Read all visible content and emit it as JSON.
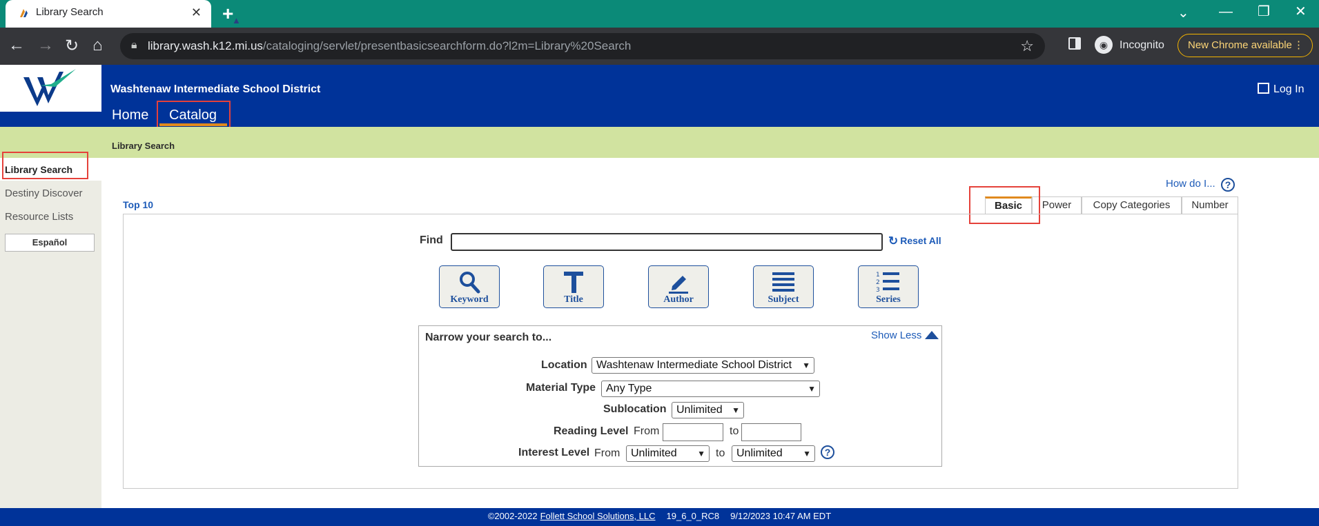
{
  "browser": {
    "tab_title": "Library Search",
    "url_host": "library.wash.k12.mi.us",
    "url_path": "/cataloging/servlet/presentbasicsearchform.do?l2m=Library%20Search",
    "incognito_label": "Incognito",
    "update_label": "New Chrome available"
  },
  "header": {
    "district": "Washtenaw Intermediate School District",
    "login": "Log In",
    "nav": {
      "home": "Home",
      "catalog": "Catalog"
    },
    "breadcrumb": "Library Search"
  },
  "sidebar": {
    "items": [
      "Library Search",
      "Destiny Discover",
      "Resource Lists"
    ],
    "language_button": "Español"
  },
  "main": {
    "how_do_i": "How do I...",
    "top10": "Top 10",
    "tabs": [
      "Basic",
      "Power",
      "Copy Categories",
      "Number"
    ],
    "find_label": "Find",
    "find_value": "",
    "reset_all": "Reset All",
    "search_buttons": [
      "Keyword",
      "Title",
      "Author",
      "Subject",
      "Series"
    ]
  },
  "narrow": {
    "title": "Narrow your search to...",
    "show_less": "Show Less",
    "location_label": "Location",
    "location_value": "Washtenaw Intermediate School District",
    "material_type_label": "Material Type",
    "material_type_value": "Any Type",
    "sublocation_label": "Sublocation",
    "sublocation_value": "Unlimited",
    "reading_level_label": "Reading Level",
    "from_label": "From",
    "to_label": "to",
    "interest_level_label": "Interest Level",
    "interest_from_value": "Unlimited",
    "interest_to_value": "Unlimited"
  },
  "footer": {
    "copyright": "©2002-2022",
    "company": "Follett School Solutions, LLC",
    "version": "19_6_0_RC8",
    "timestamp": "9/12/2023 10:47 AM EDT"
  },
  "colors": {
    "header_blue": "#003399",
    "breadcrumb_green": "#d1e3a0",
    "accent_orange": "#e08a1e",
    "highlight_red": "#e5413a"
  }
}
